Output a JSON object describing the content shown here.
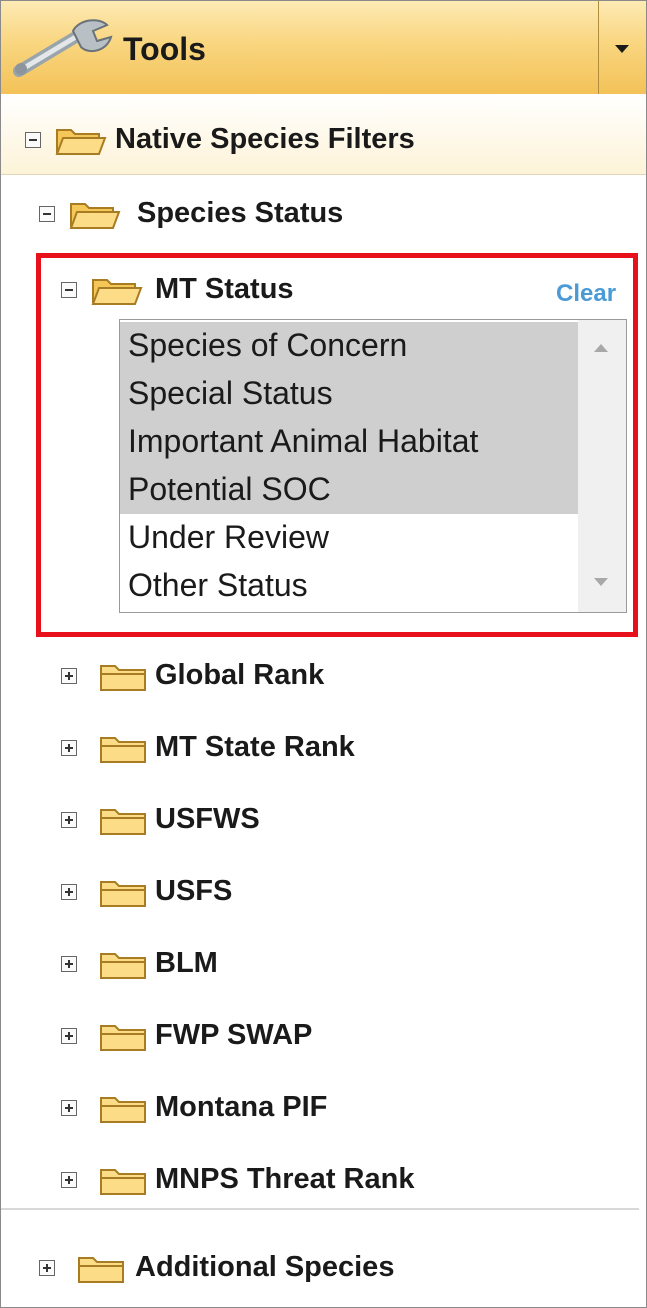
{
  "header": {
    "title": "Tools"
  },
  "tree": {
    "root": {
      "label": "Native Species Filters"
    },
    "status": {
      "label": "Species Status"
    },
    "mt_status": {
      "label": "MT Status",
      "clear_label": "Clear",
      "options": [
        {
          "label": "Species of Concern",
          "selected": true
        },
        {
          "label": "Special Status",
          "selected": true
        },
        {
          "label": "Important Animal Habitat",
          "selected": true
        },
        {
          "label": "Potential SOC",
          "selected": true
        },
        {
          "label": "Under Review",
          "selected": false
        },
        {
          "label": "Other Status",
          "selected": false
        }
      ]
    },
    "collapsed_nodes": [
      {
        "label": "Global Rank"
      },
      {
        "label": "MT State Rank"
      },
      {
        "label": "USFWS"
      },
      {
        "label": "USFS"
      },
      {
        "label": "BLM"
      },
      {
        "label": "FWP SWAP"
      },
      {
        "label": "Montana PIF"
      },
      {
        "label": "MNPS Threat Rank"
      }
    ],
    "additional": {
      "label": "Additional Species"
    }
  },
  "colors": {
    "highlight_border": "#e8101b",
    "link": "#4a9ad6",
    "selected_option_bg": "#cfcfcf",
    "header_gradient_top": "#fdeab4",
    "header_gradient_bottom": "#f3c258"
  },
  "icons": {
    "header": "wrench-icon",
    "menu": "chevron-down-icon",
    "expanded": "minus-box-icon",
    "collapsed": "plus-box-icon",
    "open_folder": "open-folder-icon",
    "closed_folder": "closed-folder-icon"
  }
}
